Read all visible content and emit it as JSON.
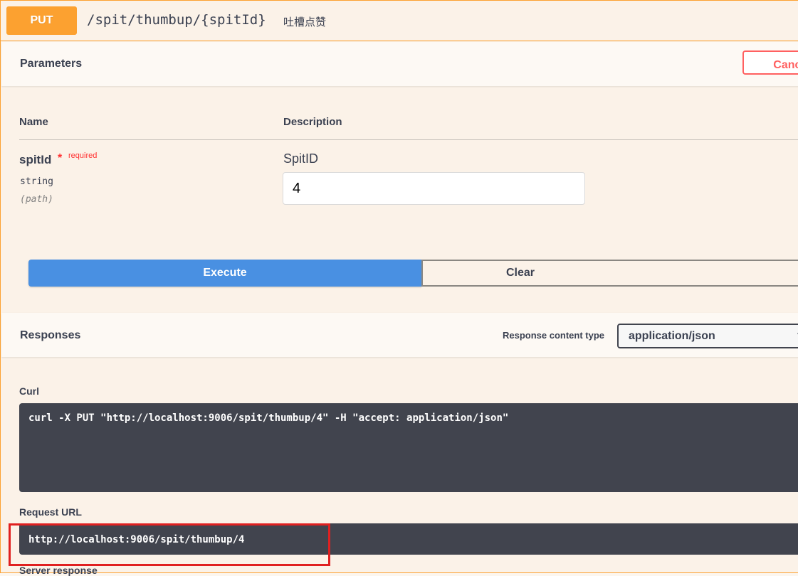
{
  "operation": {
    "method": "PUT",
    "path": "/spit/thumbup/{spitId}",
    "summary": "吐槽点赞"
  },
  "parameters": {
    "title": "Parameters",
    "cancel_label": "Cancel",
    "columns": {
      "name": "Name",
      "description": "Description"
    },
    "items": [
      {
        "name": "spitId",
        "required_star": "*",
        "required_label": "required",
        "type": "string",
        "in": "(path)",
        "description": "SpitID",
        "value": "4"
      }
    ]
  },
  "actions": {
    "execute_label": "Execute",
    "clear_label": "Clear"
  },
  "responses": {
    "title": "Responses",
    "content_type_label": "Response content type",
    "content_type_value": "application/json",
    "curl_label": "Curl",
    "curl_command": "curl -X PUT \"http://localhost:9006/spit/thumbup/4\" -H \"accept: application/json\"",
    "request_url_label": "Request URL",
    "request_url": "http://localhost:9006/spit/thumbup/4",
    "server_response_label": "Server response"
  },
  "colors": {
    "put_accent": "#fca130",
    "execute_blue": "#4990e2",
    "cancel_red": "#ff6060",
    "highlight_red": "#e02020",
    "code_bg": "#41444e"
  }
}
